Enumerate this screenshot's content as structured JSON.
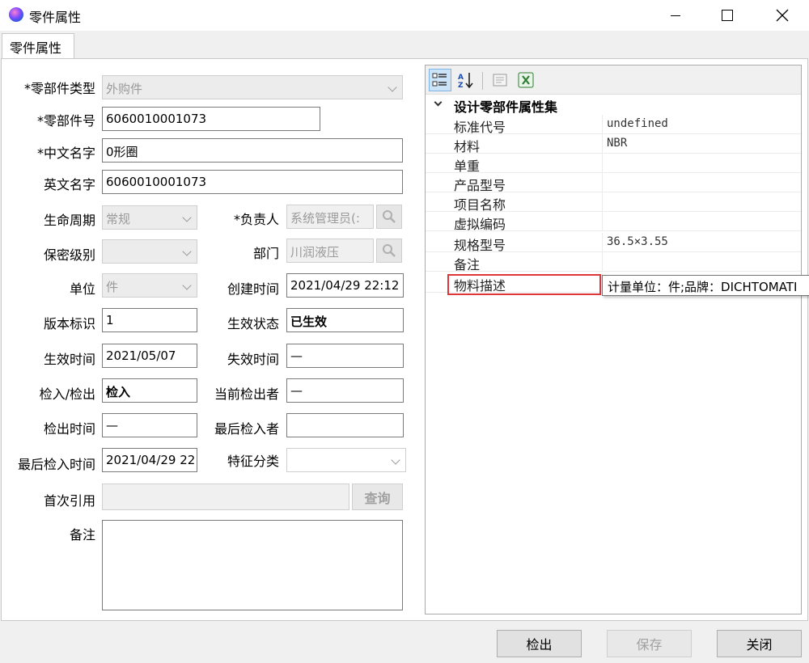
{
  "window": {
    "title": "零件属性",
    "controls": {
      "minimize": "minimize-icon",
      "maximize": "maximize-icon",
      "close": "close-icon"
    }
  },
  "tab": {
    "label": "零件属性"
  },
  "form": {
    "part_type": {
      "label": "*零部件类型",
      "value": "外购件"
    },
    "part_no": {
      "label": "*零部件号",
      "value": "6060010001073"
    },
    "cn_name": {
      "label": "*中文名字",
      "value": "0形圈"
    },
    "en_name": {
      "label": "英文名字",
      "value": "6060010001073"
    },
    "lifecycle": {
      "label": "生命周期",
      "value": "常规"
    },
    "owner": {
      "label": "*负责人",
      "value": "系统管理员(:"
    },
    "security": {
      "label": "保密级别",
      "value": ""
    },
    "department": {
      "label": "部门",
      "value": "川润液压"
    },
    "unit": {
      "label": "单位",
      "value": "件"
    },
    "created": {
      "label": "创建时间",
      "value": "2021/04/29 22:12"
    },
    "version": {
      "label": "版本标识",
      "value": "1"
    },
    "status": {
      "label": "生效状态",
      "value": "已生效"
    },
    "effective_time": {
      "label": "生效时间",
      "value": "2021/05/07"
    },
    "expire_time": {
      "label": "失效时间",
      "value": "—"
    },
    "checkin_out": {
      "label": "检入/检出",
      "value": "检入"
    },
    "current_checkout_user": {
      "label": "当前检出者",
      "value": "—"
    },
    "checkout_time": {
      "label": "检出时间",
      "value": "—"
    },
    "last_checkin_user": {
      "label": "最后检入者",
      "value": ""
    },
    "last_checkin_time": {
      "label": "最后检入时间",
      "value": "2021/04/29 22"
    },
    "feature_class": {
      "label": "特征分类",
      "value": ""
    },
    "first_ref": {
      "label": "首次引用",
      "value": "",
      "query_button": "查询"
    },
    "remarks": {
      "label": "备注",
      "value": ""
    }
  },
  "property_grid": {
    "toolbar": [
      "categorized-icon",
      "sort-az-icon",
      "property-pages-icon",
      "excel-icon"
    ],
    "category": "设计零部件属性集",
    "rows": [
      {
        "name": "标准代号",
        "value": "undefined"
      },
      {
        "name": "材料",
        "value": "NBR"
      },
      {
        "name": "单重",
        "value": ""
      },
      {
        "name": "产品型号",
        "value": ""
      },
      {
        "name": "项目名称",
        "value": ""
      },
      {
        "name": "虚拟编码",
        "value": ""
      },
      {
        "name": "规格型号",
        "value": "36.5×3.55"
      },
      {
        "name": "备注",
        "value": ""
      },
      {
        "name": "物料描述",
        "value": ""
      }
    ],
    "tooltip": "计量单位：件;品牌：DICHTOMATI"
  },
  "footer": {
    "checkout": "检出",
    "save": "保存",
    "close": "关闭"
  }
}
